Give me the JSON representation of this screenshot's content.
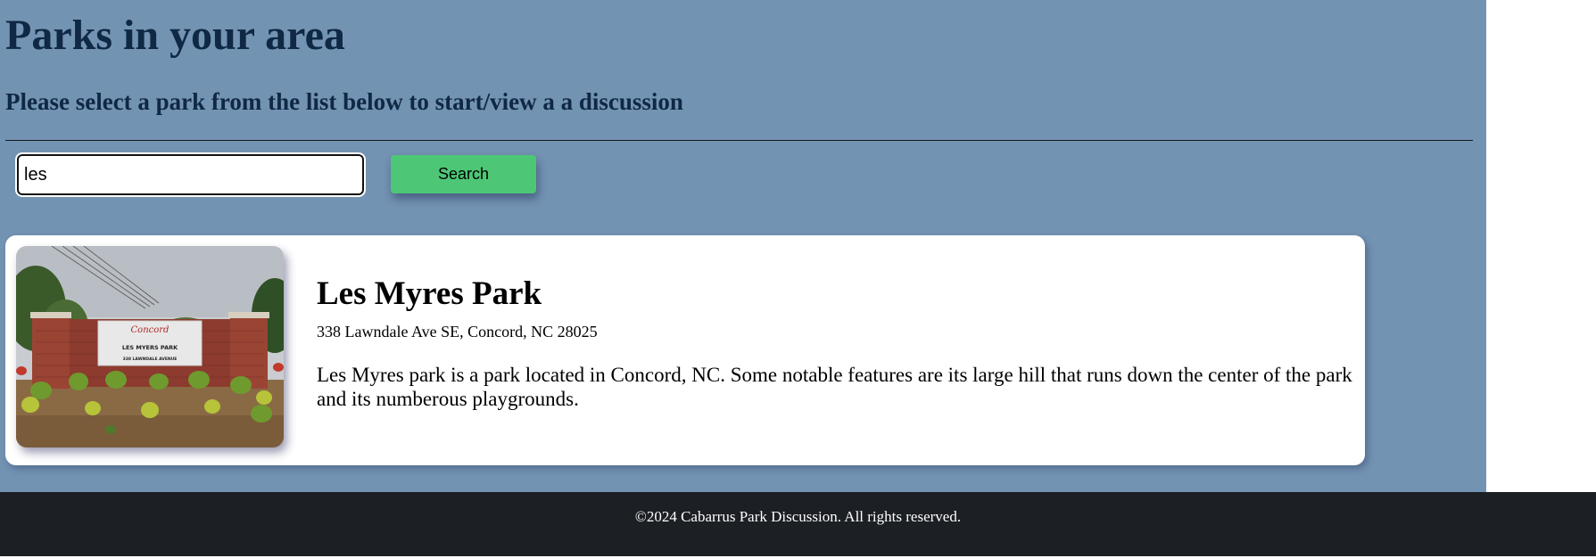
{
  "page": {
    "title": "Parks in your area",
    "subtitle": "Please select a park from the list below to start/view a a discussion"
  },
  "search": {
    "value": "les",
    "button_label": "Search"
  },
  "results": [
    {
      "name": "Les Myres Park",
      "address": "338 Lawndale Ave SE, Concord, NC 28025",
      "description": "Les Myres park is a park located in Concord, NC. Some notable features are its large hill that runs down the center of the park and its numberous playgrounds.",
      "image": {
        "sign_brand": "Concord",
        "sign_name": "LES MYERS PARK",
        "sign_address": "338 LAWNDALE AVENUE"
      }
    }
  ],
  "footer": {
    "text": "©2024 Cabarrus Park Discussion. All rights reserved."
  },
  "colors": {
    "page_background": "#7393b3",
    "heading_text": "#0f2844",
    "search_button": "#4dc776",
    "footer_background": "#1c1f23"
  }
}
